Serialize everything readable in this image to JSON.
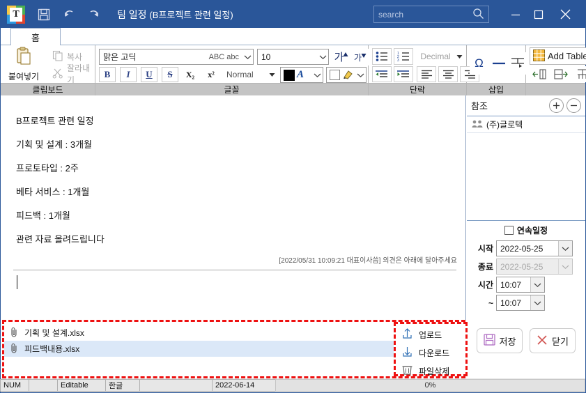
{
  "titlebar": {
    "app_icon": "app-logo-icon",
    "save_icon": "floppy-save-icon",
    "undo_icon": "undo-arrow-icon",
    "redo_icon": "redo-arrow-icon",
    "title": "팀 일정",
    "subtitle": "(B프로젝트 관련 일정)",
    "search_placeholder": "search",
    "search_value": "",
    "search_icon": "search-magnifier-icon",
    "minimize_icon": "minimize-icon",
    "maximize_icon": "maximize-icon",
    "close_icon": "close-x-icon",
    "bg_color": "#2a5699"
  },
  "tabs": [
    {
      "label": "홈",
      "active": true
    }
  ],
  "ribbon": {
    "clipboard": {
      "label": "클립보드",
      "paste": "붙여넣기",
      "paste_icon": "clipboard-paste-icon",
      "copy": "복사",
      "copy_icon": "copy-pages-icon",
      "cut": "잘라내기",
      "cut_icon": "scissors-icon"
    },
    "font": {
      "label": "글꼴",
      "font_name": "맑은 고딕",
      "font_preview": "ABC abc",
      "font_size": "10",
      "grow_font": "가",
      "shrink_font": "가",
      "bold": "B",
      "italic": "I",
      "underline": "U",
      "strike": "S",
      "subscript": "X₂",
      "superscript": "x²",
      "style_name": "Normal",
      "text_color_glyph": "A",
      "text_color": "#000000",
      "highlight_icon": "highlight-pen-icon"
    },
    "paragraph": {
      "label": "단락",
      "bullet_icon": "bullet-list-icon",
      "number_icon": "numbered-list-icon",
      "list_format": "Decimal",
      "indent_decrease_icon": "indent-decrease-icon",
      "indent_increase_icon": "indent-increase-icon",
      "align_left_icon": "align-left-icon",
      "align_center_icon": "align-center-icon",
      "align_right_icon": "align-right-icon"
    },
    "insert": {
      "label": "삽입",
      "symbol": "Ω",
      "symbol_icon": "omega-symbol-icon",
      "hline_icon": "horizontal-line-icon",
      "pagebreak_icon": "page-break-icon"
    },
    "table": {
      "add_table": "Add Table",
      "table_icon": "table-grid-icon",
      "insert_col_icon": "insert-column-icon",
      "insert_row_icon": "insert-row-icon",
      "merge_icon": "merge-cells-icon"
    }
  },
  "document": {
    "lines": [
      "B프로젝트 관련 일정",
      "기획 및 설계 : 3개월",
      "프로토타입 : 2주",
      "베타 서비스 : 1개월",
      "피드백 : 1개월",
      "관련 자료 올려드립니다"
    ],
    "meta_note": "[2022/05/31 10:09:21 대표이사씀] 의견은 아래에 달아주세요"
  },
  "reference": {
    "title": "참조",
    "add_label": "+",
    "remove_label": "−",
    "items": [
      {
        "name": "(주)글로텍",
        "icon": "group-people-icon"
      }
    ]
  },
  "schedule": {
    "recurring_label": "연속일정",
    "recurring_checked": false,
    "start_label": "시작",
    "start_value": "2022-05-25",
    "end_label": "종료",
    "end_value": "2022-05-25",
    "end_disabled": true,
    "time_label": "시간",
    "time_value": "10:07",
    "time_to_label": "~",
    "time_to_value": "10:07"
  },
  "actions": {
    "save_label": "저장",
    "save_icon": "floppy-disk-icon",
    "close_label": "닫기",
    "close_icon": "x-mark-icon"
  },
  "attachments": {
    "files": [
      {
        "name": "기획 및 설계.xlsx",
        "icon": "paperclip-icon",
        "selected": false
      },
      {
        "name": "피드백내용.xlsx",
        "icon": "paperclip-icon",
        "selected": true
      }
    ],
    "actions": [
      {
        "label": "업로드",
        "icon": "upload-arrow-icon"
      },
      {
        "label": "다운로드",
        "icon": "download-arrow-icon"
      },
      {
        "label": "파일삭제",
        "icon": "trash-can-icon"
      }
    ],
    "highlight_color": "#ee1111"
  },
  "statusbar": {
    "num": "NUM",
    "blank1": "",
    "editable": "Editable",
    "ime": "한글",
    "blank2": "",
    "date": "2022-06-14",
    "progress": "0%"
  }
}
